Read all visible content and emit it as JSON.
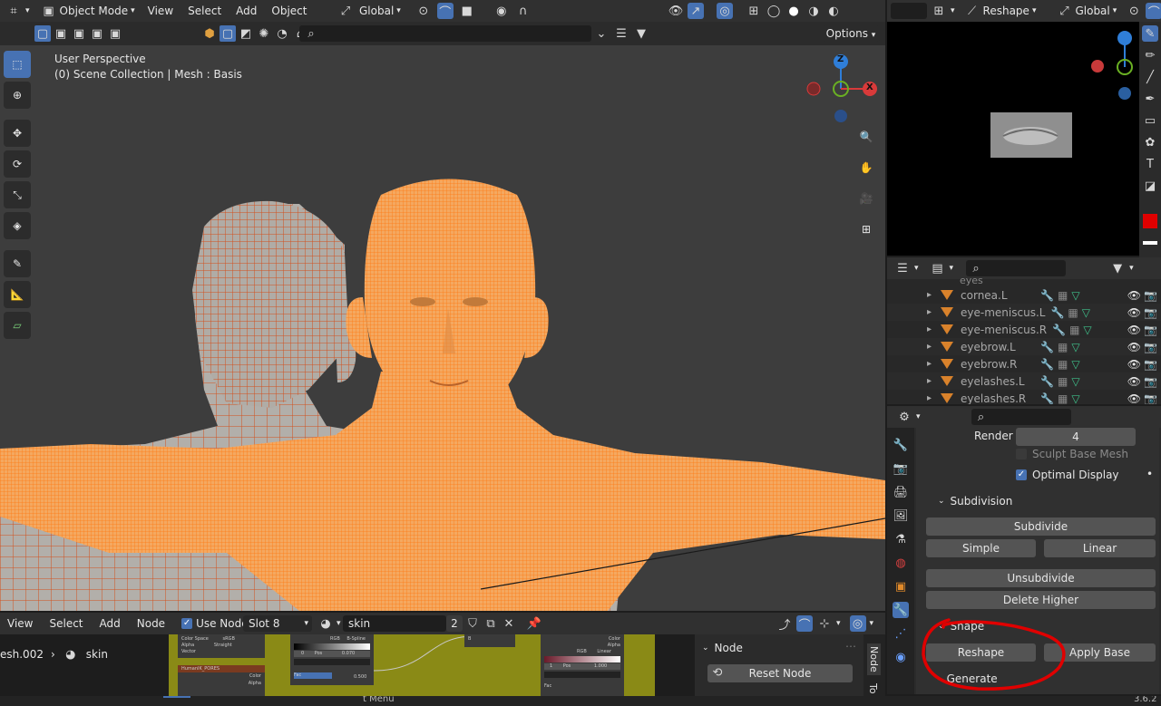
{
  "viewport_header": {
    "mode_label": "Object Mode",
    "menu": [
      "View",
      "Select",
      "Add",
      "Object"
    ],
    "transform_orientation": "Global",
    "options_label": "Options"
  },
  "viewport": {
    "perspective_label": "User Perspective",
    "collection_label": "(0) Scene Collection | Mesh : Basis",
    "gizmo": {
      "z": "Z",
      "x": "X"
    }
  },
  "right_header": {
    "mode_label": "Reshape",
    "orientation_label": "Global"
  },
  "outliner": {
    "partial_top": "eyes",
    "items": [
      {
        "name": "cornea.L"
      },
      {
        "name": "eye-meniscus.L"
      },
      {
        "name": "eye-meniscus.R"
      },
      {
        "name": "eyebrow.L"
      },
      {
        "name": "eyebrow.R"
      },
      {
        "name": "eyelashes.L"
      },
      {
        "name": "eyelashes.R"
      }
    ]
  },
  "properties": {
    "render_label": "Render",
    "render_value": "4",
    "sculpt_base_mesh": "Sculpt Base Mesh",
    "optimal_display": "Optimal Display",
    "subdivision_title": "Subdivision",
    "subdivide": "Subdivide",
    "simple": "Simple",
    "linear": "Linear",
    "unsubdivide": "Unsubdivide",
    "delete_higher": "Delete Higher",
    "shape_title": "Shape",
    "reshape": "Reshape",
    "apply_base": "Apply Base",
    "generate_title": "Generate"
  },
  "node_editor": {
    "menu": [
      "View",
      "Select",
      "Add",
      "Node"
    ],
    "use_nodes": "Use Nodes",
    "slot": "Slot 8",
    "material": "skin",
    "users": "2",
    "breadcrumb_mesh": "esh.002",
    "breadcrumb_mat": "skin",
    "side_panel_title": "Node",
    "reset_node": "Reset Node",
    "side_tab": "Node",
    "side_tab2": "To",
    "mini": {
      "n1_a": "Color Space",
      "n1_b": "Alpha",
      "n1_c": "Vector",
      "n1_d": "sRGB",
      "n1_e": "Straight",
      "n2_title": "HumanIK_PORES",
      "n2_a": "Color",
      "n2_b": "Alpha",
      "n3_a": "RGB",
      "n3_b": "B-Spline",
      "n3_c": "Pos",
      "n3_d": "0.070",
      "n3_e": "Fac",
      "n3_f": "0.500",
      "n3_g": "0",
      "n4_a": "Color",
      "n4_b": "Alpha",
      "n5_a": "RGB",
      "n5_b": "Linear",
      "n5_c": "Pos",
      "n5_d": "1.000",
      "n5_e": "1",
      "n5_f": "Fac",
      "n6": "B"
    }
  },
  "status_bar": {
    "menu_hint": "t Menu",
    "version": "3.6.2"
  },
  "colors": {
    "accent": "#4772b3",
    "wire": "#ff8a1f",
    "annotation": "#e00000",
    "node_bg": "#8a8a16"
  }
}
